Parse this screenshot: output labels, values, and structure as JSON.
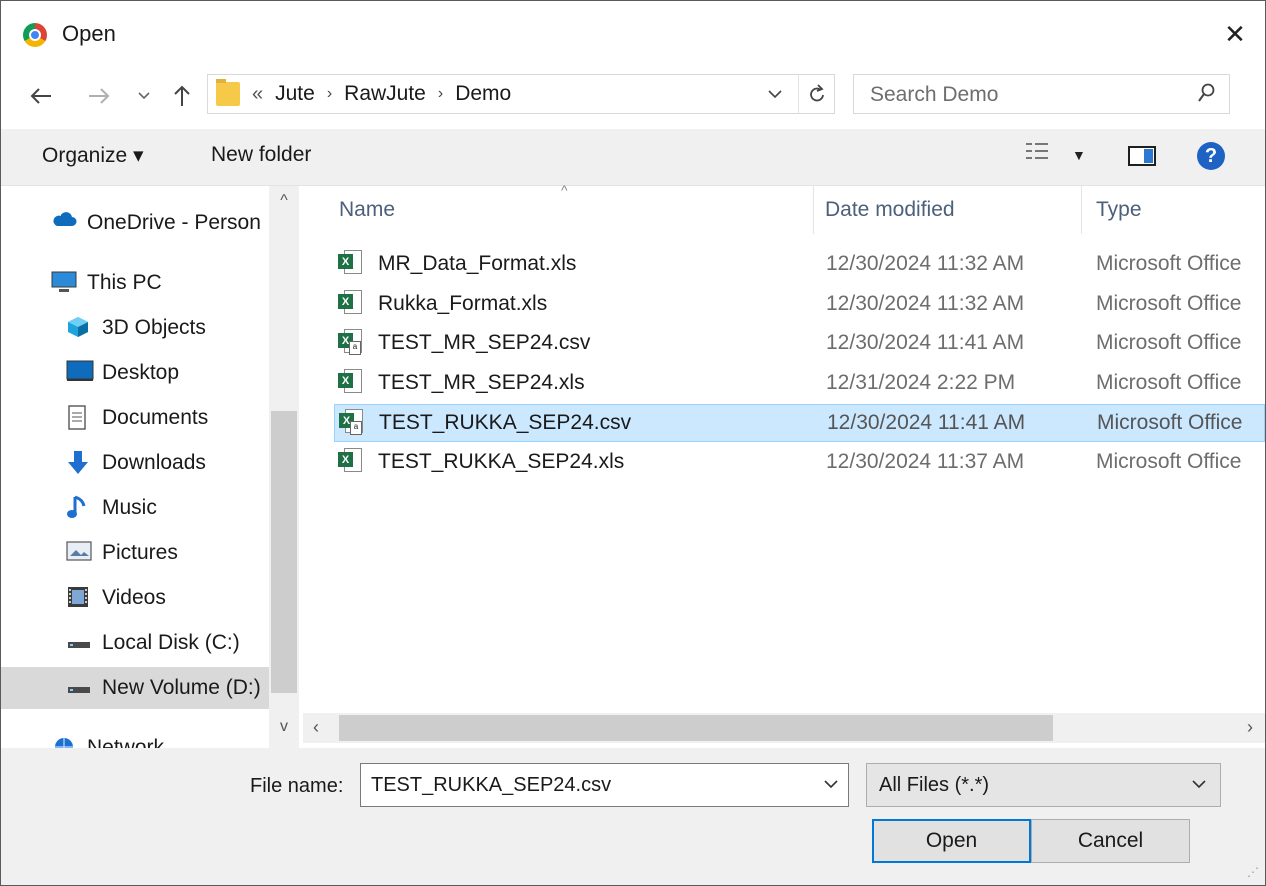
{
  "window": {
    "title": "Open",
    "close_glyph": "✕"
  },
  "nav": {
    "back_icon": "arrow-left-icon",
    "forward_icon": "arrow-right-icon",
    "recent_icon": "chevron-down-icon",
    "up_icon": "arrow-up-icon"
  },
  "address": {
    "overflow": "«",
    "crumbs": [
      "Jute",
      "RawJute",
      "Demo"
    ]
  },
  "search": {
    "placeholder": "Search Demo"
  },
  "toolbar": {
    "organize": "Organize ▾",
    "new_folder": "New folder",
    "help": "?"
  },
  "sidebar": {
    "items": [
      {
        "label": "OneDrive - Person",
        "icon": "cloud-icon",
        "indent": false
      },
      {
        "label": "This PC",
        "icon": "computer-icon",
        "indent": false
      },
      {
        "label": "3D Objects",
        "icon": "cube-icon",
        "indent": true
      },
      {
        "label": "Desktop",
        "icon": "desktop-icon",
        "indent": true
      },
      {
        "label": "Documents",
        "icon": "document-icon",
        "indent": true
      },
      {
        "label": "Downloads",
        "icon": "download-icon",
        "indent": true
      },
      {
        "label": "Music",
        "icon": "music-icon",
        "indent": true
      },
      {
        "label": "Pictures",
        "icon": "pictures-icon",
        "indent": true
      },
      {
        "label": "Videos",
        "icon": "videos-icon",
        "indent": true
      },
      {
        "label": "Local Disk (C:)",
        "icon": "drive-icon",
        "indent": true
      },
      {
        "label": "New Volume (D:)",
        "icon": "drive-icon",
        "indent": true,
        "selected": true
      },
      {
        "label": "Network",
        "icon": "network-icon",
        "indent": false
      }
    ]
  },
  "columns": {
    "name": "Name",
    "date": "Date modified",
    "type": "Type"
  },
  "files": [
    {
      "name": "MR_Data_Format.xls",
      "date": "12/30/2024 11:32 AM",
      "type": "Microsoft Office",
      "kind": "xls"
    },
    {
      "name": "Rukka_Format.xls",
      "date": "12/30/2024 11:32 AM",
      "type": "Microsoft Office",
      "kind": "xls"
    },
    {
      "name": "TEST_MR_SEP24.csv",
      "date": "12/30/2024 11:41 AM",
      "type": "Microsoft Office",
      "kind": "csv"
    },
    {
      "name": "TEST_MR_SEP24.xls",
      "date": "12/31/2024 2:22 PM",
      "type": "Microsoft Office",
      "kind": "xls"
    },
    {
      "name": "TEST_RUKKA_SEP24.csv",
      "date": "12/30/2024 11:41 AM",
      "type": "Microsoft Office",
      "kind": "csv",
      "selected": true
    },
    {
      "name": "TEST_RUKKA_SEP24.xls",
      "date": "12/30/2024 11:37 AM",
      "type": "Microsoft Office",
      "kind": "xls"
    }
  ],
  "footer": {
    "file_name_label": "File name:",
    "file_name_value": "TEST_RUKKA_SEP24.csv",
    "file_type": "All Files (*.*)",
    "open": "Open",
    "cancel": "Cancel"
  },
  "colors": {
    "selection_bg": "#cce8ff",
    "accent": "#0078d7",
    "help_blue": "#1e63c4"
  }
}
